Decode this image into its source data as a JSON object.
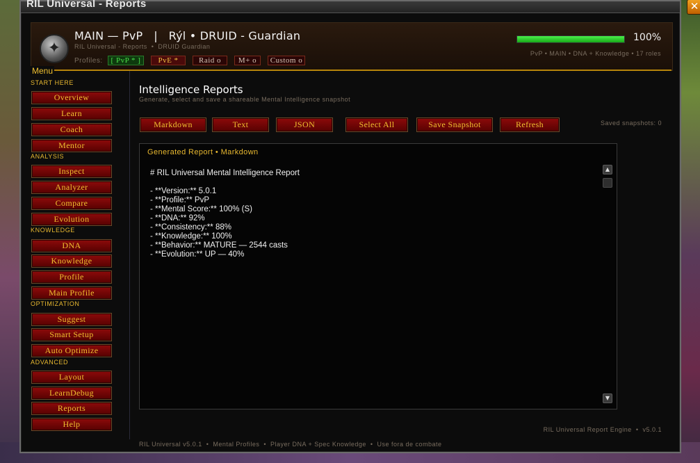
{
  "window": {
    "title": "RIL Universal - Reports",
    "close_label": "✕"
  },
  "header": {
    "main_title": "MAIN — PvP   |   Rýl • DRUID - Guardian",
    "subtitle": "RIL Universal - Reports  •  DRUID Guardian",
    "profiles_label": "Profiles:",
    "profiles": [
      {
        "label": "[ PvP * ]",
        "state": "active"
      },
      {
        "label": "PvE *",
        "state": "normal"
      },
      {
        "label": "Raid o",
        "state": "dim"
      },
      {
        "label": "M+ o",
        "state": "dim"
      },
      {
        "label": "Custom o",
        "state": "dim"
      }
    ],
    "progress_percent": 100,
    "progress_label": "100%",
    "right_subtitle": "PvP • MAIN • DNA + Knowledge • 17 roles"
  },
  "menu": {
    "title": "Menu",
    "sections": [
      {
        "label": "START HERE",
        "items": [
          "Overview",
          "Learn",
          "Coach",
          "Mentor"
        ]
      },
      {
        "label": "ANALYSIS",
        "items": [
          "Inspect",
          "Analyzer",
          "Compare",
          "Evolution"
        ]
      },
      {
        "label": "KNOWLEDGE",
        "items": [
          "DNA",
          "Knowledge",
          "Profile",
          "Main Profile"
        ]
      },
      {
        "label": "OPTIMIZATION",
        "items": [
          "Suggest",
          "Smart Setup",
          "Auto Optimize"
        ]
      },
      {
        "label": "ADVANCED",
        "items": [
          "Layout",
          "LearnDebug",
          "Reports",
          "Help"
        ]
      }
    ]
  },
  "main": {
    "title": "Intelligence Reports",
    "subtitle": "Generate, select and save a shareable Mental Intelligence snapshot",
    "actions": [
      "Markdown",
      "Text",
      "JSON",
      "Select All",
      "Save Snapshot",
      "Refresh"
    ],
    "saved_snapshots": "Saved snapshots: 0",
    "report": {
      "header": "Generated Report • Markdown",
      "lines": [
        "# RIL Universal Mental Intelligence Report",
        "",
        "- **Version:** 5.0.1",
        "- **Profile:** PvP",
        "- **Mental Score:** 100% (S)",
        "- **DNA:** 92%",
        "- **Consistency:** 88%",
        "- **Knowledge:** 100%",
        "- **Behavior:** MATURE — 2544 casts",
        "- **Evolution:** UP — 40%"
      ]
    },
    "engine_label": "RIL Universal Report Engine  •  v5.0.1"
  },
  "footer": "RIL Universal v5.0.1  •  Mental Profiles  •  Player DNA + Spec Knowledge  •  Use fora de combate",
  "icons": {
    "emblem": "guardian-bear-emblem-icon",
    "scroll_up": "scroll-up-icon",
    "scroll_down": "scroll-down-icon",
    "close": "close-icon"
  },
  "colors": {
    "accent_gold": "#f0c030",
    "button_red": "#7a0606",
    "progress_green": "#2ad02a",
    "active_tab_green": "#4adf4a"
  }
}
